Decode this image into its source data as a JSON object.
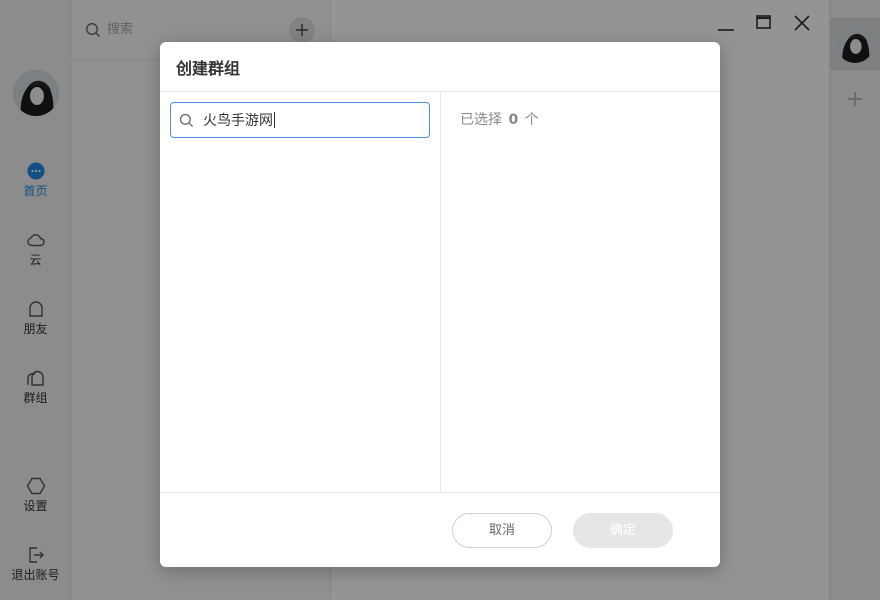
{
  "sidebar": {
    "items": [
      {
        "label": "首页",
        "icon": "chat-bubble-icon",
        "active": true
      },
      {
        "label": "云",
        "icon": "cloud-icon",
        "active": false
      },
      {
        "label": "朋友",
        "icon": "friend-icon",
        "active": false
      },
      {
        "label": "群组",
        "icon": "group-icon",
        "active": false
      }
    ],
    "bottom_items": [
      {
        "label": "设置",
        "icon": "hexagon-settings-icon"
      },
      {
        "label": "退出账号",
        "icon": "logout-icon"
      }
    ]
  },
  "list_panel": {
    "search_placeholder": "搜索"
  },
  "dialog": {
    "title": "创建群组",
    "search_value": "火鸟手游网",
    "selected_prefix": "已选择",
    "selected_count": "0",
    "selected_suffix": "个",
    "cancel_label": "取消",
    "confirm_label": "确定"
  },
  "colors": {
    "accent": "#1e88e5",
    "input_border": "#4a90e2",
    "overlay": "rgba(0,0,0,0.42)",
    "confirm_disabled": "#e6e6e6"
  }
}
